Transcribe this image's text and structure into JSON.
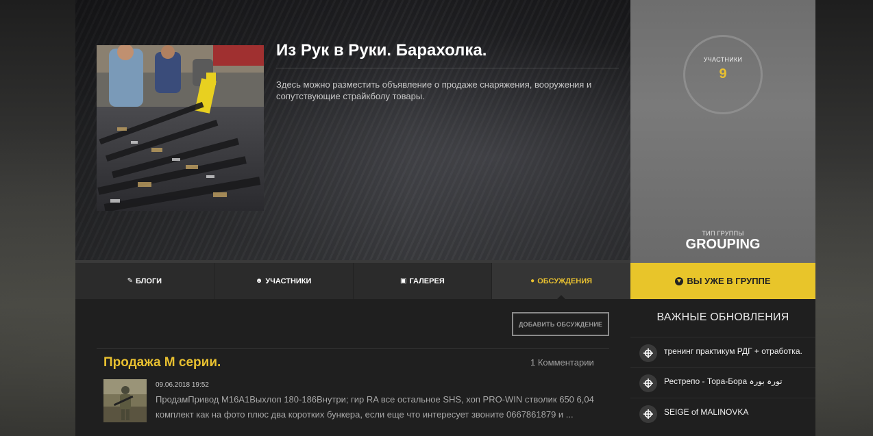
{
  "group": {
    "title": "Из Рук в Руки. Барахолка.",
    "description": "Здесь можно разместить объявление о продаже снаряжения, вооружения и сопутствующие страйкболу товары.",
    "members_label": "Участники",
    "members_count": "9",
    "type_label": "Тип группы",
    "type_value": "GROUPING"
  },
  "tabs": [
    {
      "label": "Блоги",
      "icon": "edit-icon"
    },
    {
      "label": "Участники",
      "icon": "users-icon"
    },
    {
      "label": "Галерея",
      "icon": "picture-icon"
    },
    {
      "label": "Обсуждения",
      "icon": "comments-icon",
      "active": true
    }
  ],
  "join_button": {
    "label": "Вы уже в группе",
    "icon": "arrow-circle-down-icon"
  },
  "discussions": {
    "add_label": "Добавить обсуждение",
    "post": {
      "title": "Продажа М серии.",
      "comments": "1 Комментарии",
      "date": "09.06.2018 19:52",
      "excerpt": "ПродамПривод М16А1Выхлоп 180-186Внутри; гир RA все остальное SHS, хоп PRO-WIN стволик 650 6,04 комплект как на фото плюс два коротких бункера, если еще что интересует звоните 0667861879 и ..."
    }
  },
  "sidebar": {
    "heading": "Важные обновления",
    "updates": [
      {
        "text": "тренинг практикум РДГ + отработка.",
        "icon": "crosshair-icon"
      },
      {
        "text": "Рестрепо - Тора-Бора تورہ بورہ",
        "icon": "crosshair-icon"
      },
      {
        "text": "SEIGE of MALINOVKA",
        "icon": "crosshair-icon"
      }
    ]
  },
  "colors": {
    "accent": "#e8c52a",
    "link_yellow": "#e8c030",
    "panel_dark": "#1f1f1f",
    "tabs_bg": "#2b2b2b"
  }
}
